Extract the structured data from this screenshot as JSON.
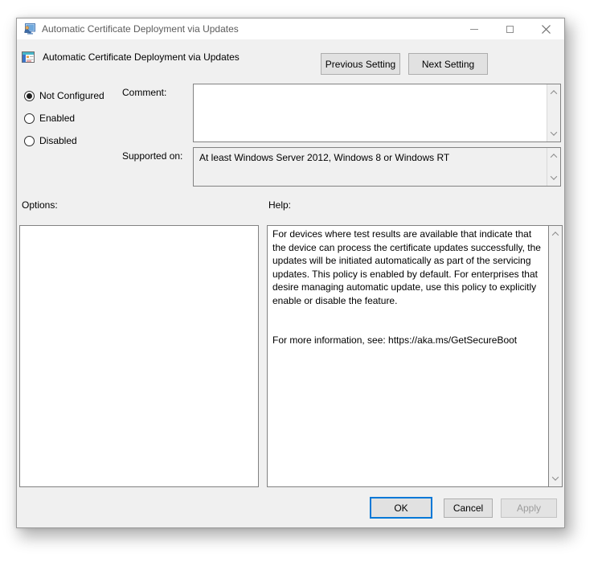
{
  "window": {
    "title": "Automatic Certificate Deployment via Updates"
  },
  "header": {
    "policy_title": "Automatic Certificate Deployment via Updates",
    "previous_label": "Previous Setting",
    "next_label": "Next Setting"
  },
  "config": {
    "radios": [
      {
        "label": "Not Configured",
        "selected": true
      },
      {
        "label": "Enabled",
        "selected": false
      },
      {
        "label": "Disabled",
        "selected": false
      }
    ],
    "comment": {
      "label": "Comment:",
      "value": ""
    },
    "supported": {
      "label": "Supported on:",
      "value": "At least Windows Server 2012, Windows 8 or Windows RT"
    }
  },
  "options": {
    "label": "Options:"
  },
  "help": {
    "label": "Help:",
    "paragraph": "For devices where test results are available that indicate that the device can process the certificate updates successfully, the updates will be initiated automatically as part of the servicing updates. This policy is enabled by default. For enterprises that desire managing automatic update, use this policy to explicitly enable or disable the feature.",
    "more_info": "For more information, see: https://aka.ms/GetSecureBoot"
  },
  "footer": {
    "ok_label": "OK",
    "cancel_label": "Cancel",
    "apply_label": "Apply"
  },
  "icons": {
    "titlebar": "group-policy-console-icon",
    "header": "policy-setting-icon",
    "scroll_up": "chevron-up",
    "scroll_down": "chevron-down"
  },
  "colors": {
    "accent": "#0078d7",
    "dialog_bg": "#f0f0f0",
    "titlebar_bg": "#ffffff",
    "box_border": "#828282",
    "button_bg": "#e1e1e1",
    "button_border": "#adadad",
    "disabled_text": "#9c9c9c"
  }
}
